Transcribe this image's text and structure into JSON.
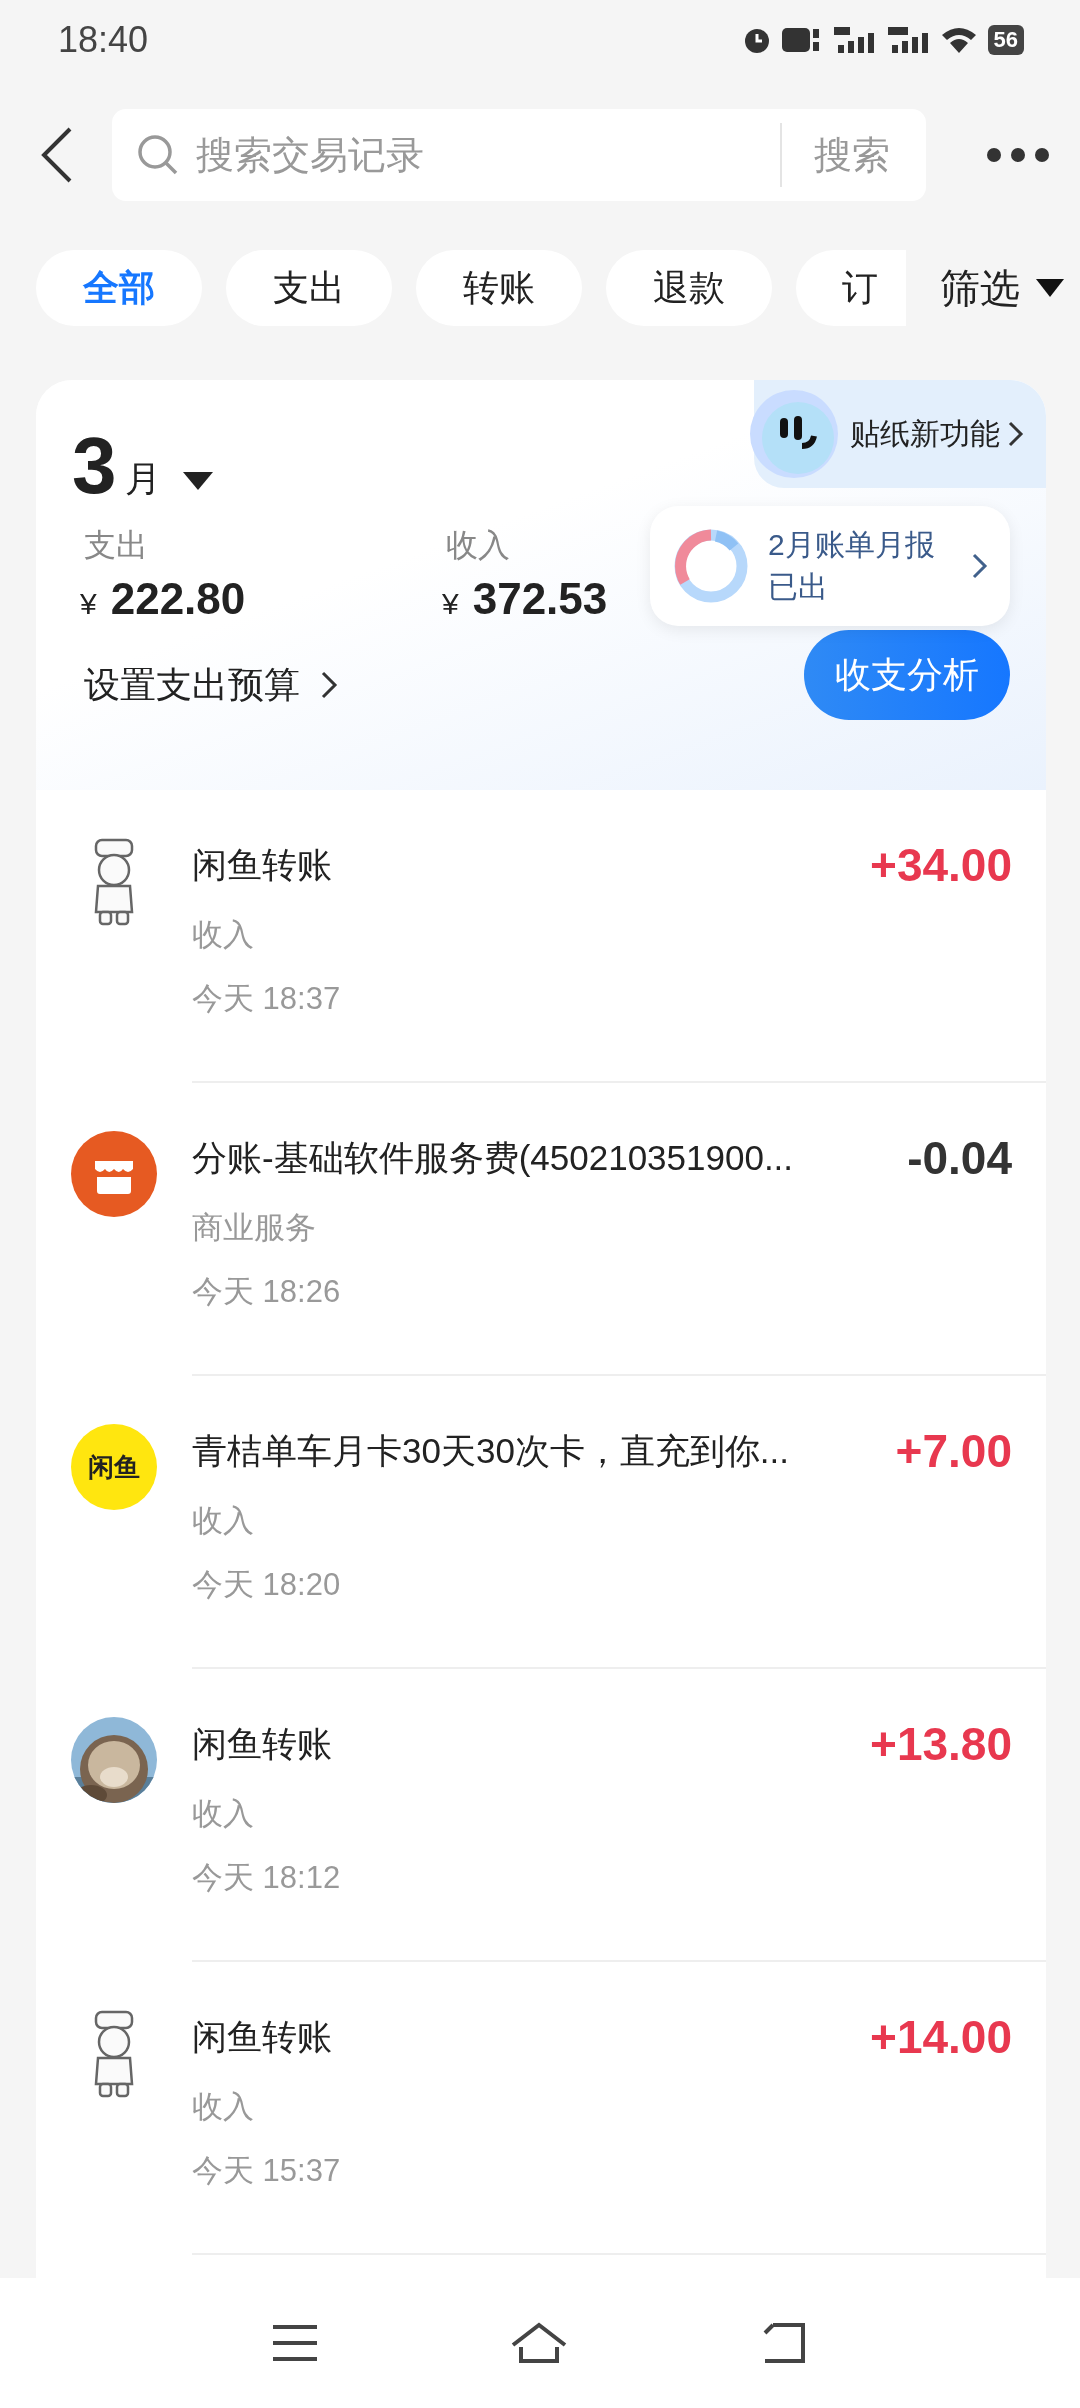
{
  "status_bar": {
    "time": "18:40",
    "battery": "56"
  },
  "search": {
    "placeholder": "搜索交易记录",
    "button": "搜索"
  },
  "filters": [
    {
      "label": "全部",
      "selected": true
    },
    {
      "label": "支出",
      "selected": false
    },
    {
      "label": "转账",
      "selected": false
    },
    {
      "label": "退款",
      "selected": false
    },
    {
      "label": "订",
      "selected": false
    }
  ],
  "filter_menu": "筛选",
  "summary": {
    "month": "3",
    "month_unit": "月",
    "expense": {
      "label": "支出",
      "currency": "¥",
      "amount": "222.80"
    },
    "income": {
      "label": "收入",
      "currency": "¥",
      "amount": "372.53"
    },
    "budget_link": "设置支出预算",
    "analysis_button": "收支分析"
  },
  "sticker_promo": "贴纸新功能",
  "report_tip": "2月账单月报已出",
  "transactions": [
    {
      "kind": "sketch",
      "title": "闲鱼转账",
      "category": "收入",
      "time": "今天 18:37",
      "amount": "+34.00",
      "color": "#e8384f"
    },
    {
      "kind": "shop",
      "title": "分账-基础软件服务费(450210351900...",
      "category": "商业服务",
      "time": "今天 18:26",
      "amount": "-0.04",
      "color": "#333333"
    },
    {
      "kind": "logo",
      "avatar_text": "闲鱼",
      "title": "青桔单车月卡30天30次卡，直充到你...",
      "category": "收入",
      "time": "今天 18:20",
      "amount": "+7.00",
      "color": "#e8384f"
    },
    {
      "title": "闲鱼转账",
      "category": "收入",
      "time": "今天 18:12",
      "amount": "+13.80",
      "color": "#e8384f"
    },
    {
      "kind": "sketch",
      "title": "闲鱼转账",
      "category": "收入",
      "time": "今天 15:37",
      "amount": "+14.00",
      "color": "#e8384f"
    }
  ]
}
